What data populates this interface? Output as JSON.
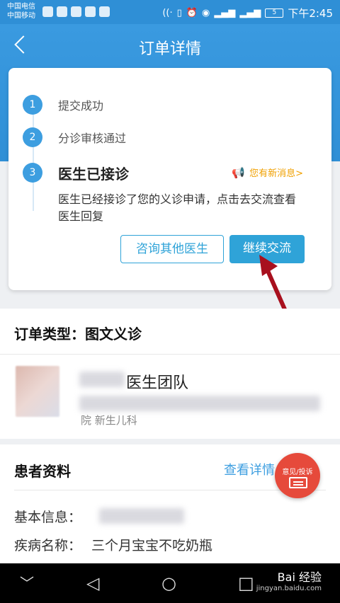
{
  "status_bar": {
    "carrier1": "中国电信",
    "carrier2": "中国移动",
    "battery": "5",
    "time": "下午2:45"
  },
  "header": {
    "title": "订单详情"
  },
  "progress": {
    "steps": [
      {
        "number": "1",
        "label": "提交成功"
      },
      {
        "number": "2",
        "label": "分诊审核通过"
      },
      {
        "number": "3",
        "label": "医生已接诊"
      }
    ],
    "notification": "您有新消息>",
    "description": "医生已经接诊了您的义诊申请，点击去交流查看医生回复",
    "btn_consult_other": "咨询其他医生",
    "btn_continue": "继续交流"
  },
  "order_type": {
    "label": "订单类型：图文义诊"
  },
  "doctor": {
    "team": "医生团队",
    "department": "院 新生儿科"
  },
  "patient": {
    "title": "患者资料",
    "view_detail": "查看详情",
    "basic_info_label": "基本信息：",
    "disease_label": "疾病名称：",
    "disease_value": "三个月宝宝不吃奶瓶"
  },
  "fab": {
    "label": "意见/投诉"
  },
  "watermark": {
    "brand": "Bai 经验",
    "url": "jingyan.baidu.com"
  },
  "colors": {
    "primary": "#2fa3d8",
    "header": "#2f8fd6",
    "notify": "#f0a000",
    "fab": "#e64a3b",
    "arrow": "#a8101e"
  }
}
